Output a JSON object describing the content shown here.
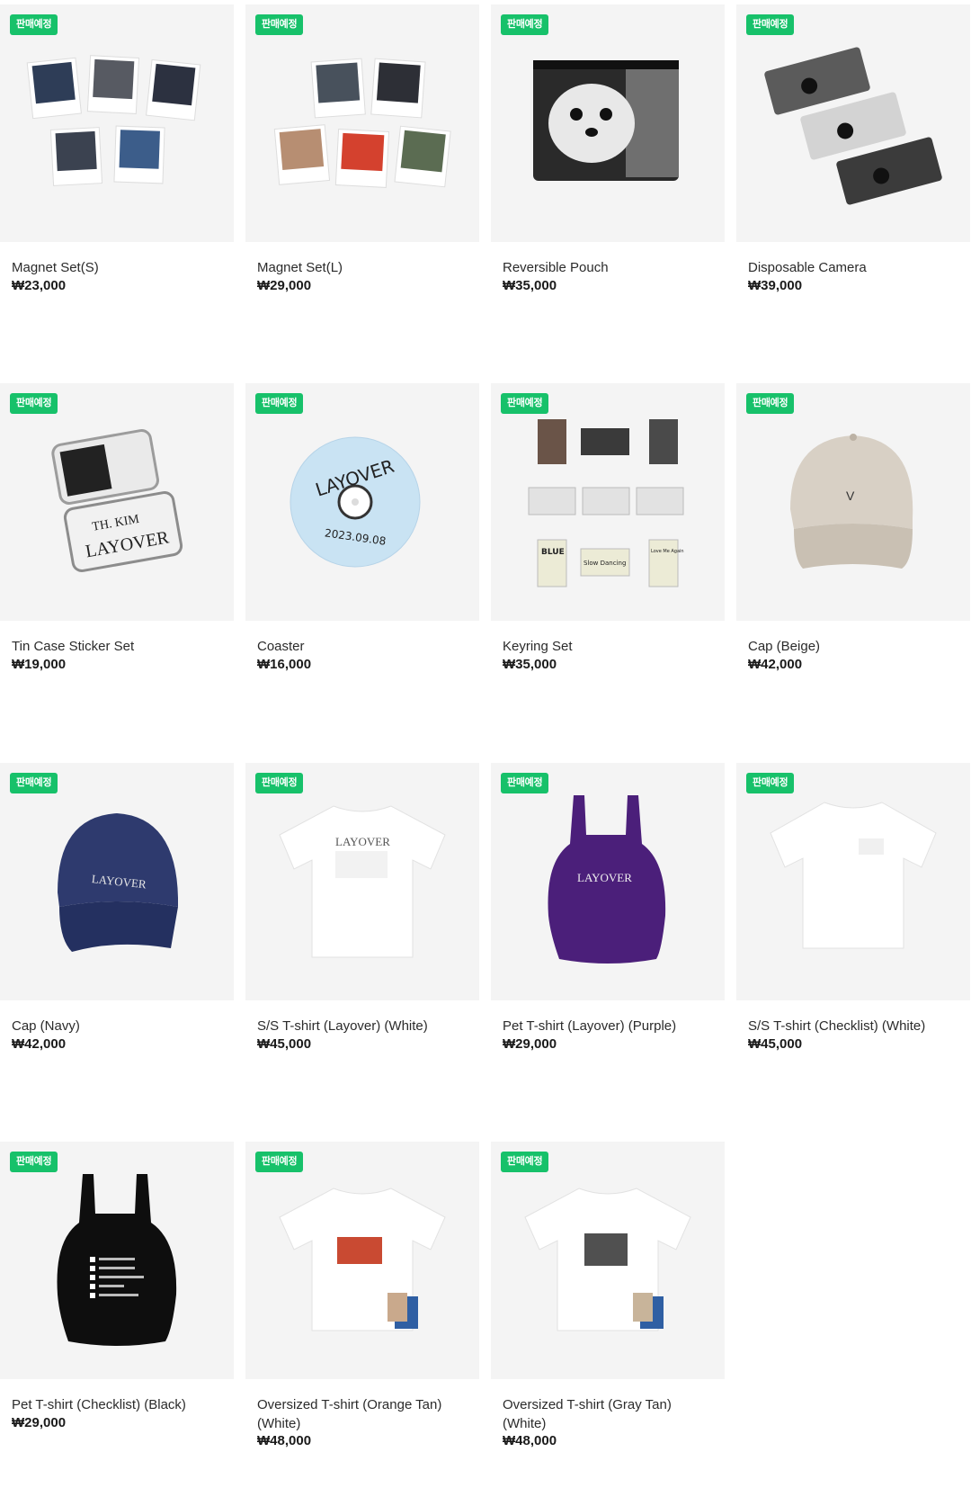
{
  "products": [
    {
      "name": "Magnet Set(S)",
      "price": "₩23,000",
      "badge": "판매예정",
      "image": "magnet-set-small-image"
    },
    {
      "name": "Magnet Set(L)",
      "price": "₩29,000",
      "badge": "판매예정",
      "image": "magnet-set-large-image"
    },
    {
      "name": "Reversible Pouch",
      "price": "₩35,000",
      "badge": "판매예정",
      "image": "reversible-pouch-image"
    },
    {
      "name": "Disposable Camera",
      "price": "₩39,000",
      "badge": "판매예정",
      "image": "disposable-camera-image"
    },
    {
      "name": "Tin Case Sticker Set",
      "price": "₩19,000",
      "badge": "판매예정",
      "image": "tin-case-sticker-set-image"
    },
    {
      "name": "Coaster",
      "price": "₩16,000",
      "badge": "판매예정",
      "image": "coaster-image"
    },
    {
      "name": "Keyring Set",
      "price": "₩35,000",
      "badge": "판매예정",
      "image": "keyring-set-image"
    },
    {
      "name": "Cap (Beige)",
      "price": "₩42,000",
      "badge": "판매예정",
      "image": "cap-beige-image"
    },
    {
      "name": "Cap (Navy)",
      "price": "₩42,000",
      "badge": "판매예정",
      "image": "cap-navy-image"
    },
    {
      "name": "S/S T-shirt (Layover) (White)",
      "price": "₩45,000",
      "badge": "판매예정",
      "image": "tshirt-layover-white-image"
    },
    {
      "name": "Pet T-shirt (Layover) (Purple)",
      "price": "₩29,000",
      "badge": "판매예정",
      "image": "pet-tshirt-layover-purple-image"
    },
    {
      "name": "S/S T-shirt (Checklist) (White)",
      "price": "₩45,000",
      "badge": "판매예정",
      "image": "tshirt-checklist-white-image"
    },
    {
      "name": "Pet T-shirt (Checklist) (Black)",
      "price": "₩29,000",
      "badge": "판매예정",
      "image": "pet-tshirt-checklist-black-image"
    },
    {
      "name": "Oversized T-shirt (Orange Tan) (White)",
      "price": "₩48,000",
      "badge": "판매예정",
      "image": "oversized-tshirt-orange-tan-image"
    },
    {
      "name": "Oversized T-shirt (Gray Tan) (White)",
      "price": "₩48,000",
      "badge": "판매예정",
      "image": "oversized-tshirt-gray-tan-image"
    }
  ],
  "artwork_text": {
    "layover": "LAYOVER",
    "coaster_date": "2023.09.08",
    "tin_name": "TH. KIM",
    "keyring_blue": "BLUE",
    "keyring_slow": "Slow Dancing",
    "keyring_love": "Love Me Again"
  }
}
